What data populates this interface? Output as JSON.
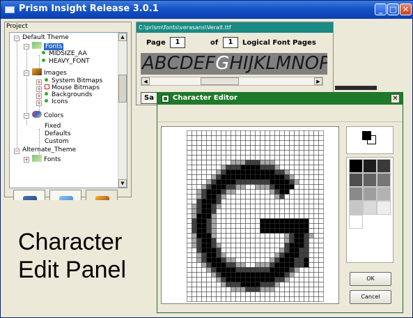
{
  "window": {
    "title": "Prism Insight Release 3.0.1",
    "accent": "#1453c7"
  },
  "project_panel": {
    "header": "Project",
    "tree": {
      "default_theme": "Default Theme",
      "fonts": "Fonts",
      "font_items": [
        "MIDSIZE_AA",
        "HEAVY_FONT"
      ],
      "images": "Images",
      "image_items": [
        "System Bitmaps",
        "Mouse Bitmaps",
        "Backgrounds",
        "Icons"
      ],
      "colors": "Colors",
      "color_items": [
        "Fixed",
        "Defaults",
        "Custom"
      ],
      "alternate_theme": "Alternate_Theme",
      "alt_fonts": "Fonts"
    },
    "tabs": [
      {
        "icon": "resources-icon"
      },
      {
        "icon": "widgets-icon"
      },
      {
        "icon": "character-edit-icon"
      }
    ]
  },
  "char_panel": {
    "line1": "Character",
    "line2": "Edit Panel"
  },
  "font_view": {
    "path": "C:\\prism\\fonts\\verasans\\Veralt.ttf",
    "page_label": "Page",
    "page_value": "1",
    "of_label": "of",
    "total_value": "1",
    "pages_label": "Logical Font Pages",
    "glyphs_before": "ABCDEF",
    "glyph_selected": "G",
    "glyphs_after": "HIJKLMNOP",
    "save_label": "Sa"
  },
  "char_editor": {
    "title": "Character Editor",
    "close_glyph": "✕",
    "ok_label": "OK",
    "cancel_label": "Cancel",
    "foreground": "#000000",
    "background": "#ffffff",
    "palette": [
      "#000000",
      "#1c1c1c",
      "#3a3a3a",
      "#4e4e4e",
      "#626262",
      "#767676",
      "#8a8a8a",
      "#9e9e9e",
      "#b2b2b2",
      "#c6c6c6",
      "#dadada",
      "#eeeeee",
      "#ffffff"
    ]
  }
}
